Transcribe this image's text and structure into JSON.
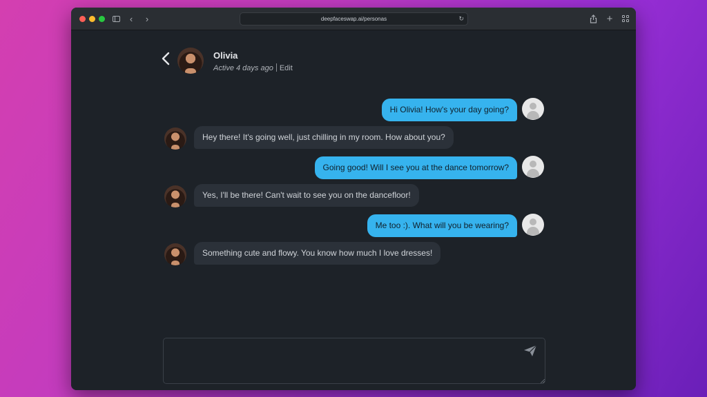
{
  "browser": {
    "url": "deepfaceswap.ai/personas"
  },
  "colors": {
    "user_bubble": "#36b3ee",
    "persona_bubble": "#2b3139",
    "background": "#1d2228"
  },
  "header": {
    "name": "Olivia",
    "status": "Active 4 days ago",
    "edit_label": "Edit"
  },
  "messages": [
    {
      "sender": "user",
      "text": "Hi Olivia! How's your day going?"
    },
    {
      "sender": "persona",
      "text": "Hey there! It's going well, just chilling in my room. How about you?"
    },
    {
      "sender": "user",
      "text": "Going good! Will I see you at the dance tomorrow?"
    },
    {
      "sender": "persona",
      "text": "Yes, I'll be there! Can't wait to see you on the dancefloor!"
    },
    {
      "sender": "user",
      "text": "Me too :). What will you be wearing?"
    },
    {
      "sender": "persona",
      "text": "Something cute and flowy. You know how much I love dresses!"
    }
  ],
  "composer": {
    "value": "",
    "send_icon": "paper-plane-icon"
  }
}
